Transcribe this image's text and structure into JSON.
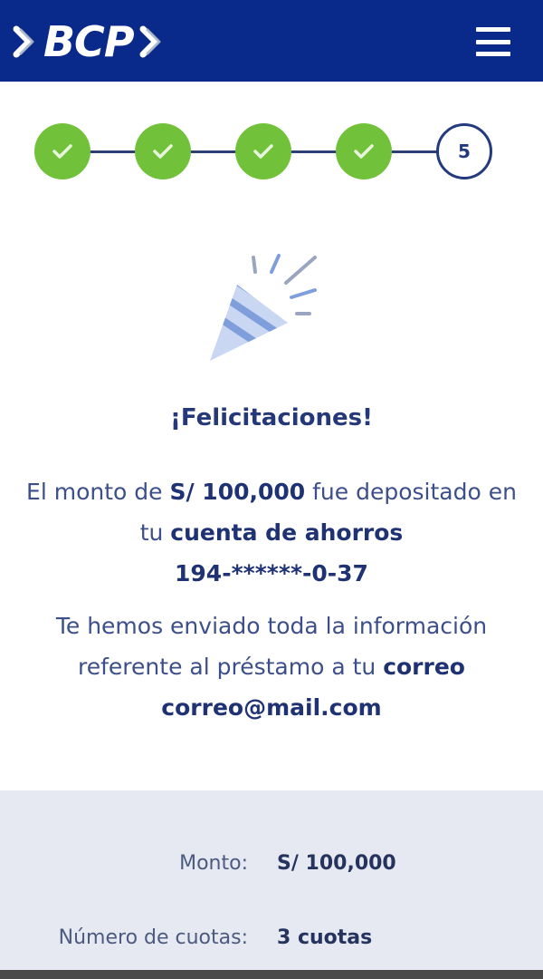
{
  "header": {
    "brand": "BCP",
    "menu_icon": "hamburger-menu-icon",
    "bg_color": "#0a2a8b"
  },
  "stepper": {
    "current_step_label": "5",
    "completed_steps": 4,
    "done_color": "#72c13a",
    "done_icon": "check-icon"
  },
  "confirmation": {
    "icon": "party-popper-icon",
    "title": "¡Felicitaciones!",
    "deposit": {
      "t1": "El monto de ",
      "amount": "S/ 100,000",
      "t2": " fue depositado en tu ",
      "account_type": "cuenta de ahorros",
      "account_number": "194-******-0-37"
    },
    "email": {
      "t1": "Te hemos enviado toda la información referente al préstamo a tu ",
      "label": "correo",
      "address": "correo@mail.com"
    }
  },
  "summary": {
    "rows": [
      {
        "label": "Monto:",
        "value": "S/ 100,000"
      },
      {
        "label": "Número de cuotas:",
        "value": "3 cuotas"
      }
    ]
  }
}
